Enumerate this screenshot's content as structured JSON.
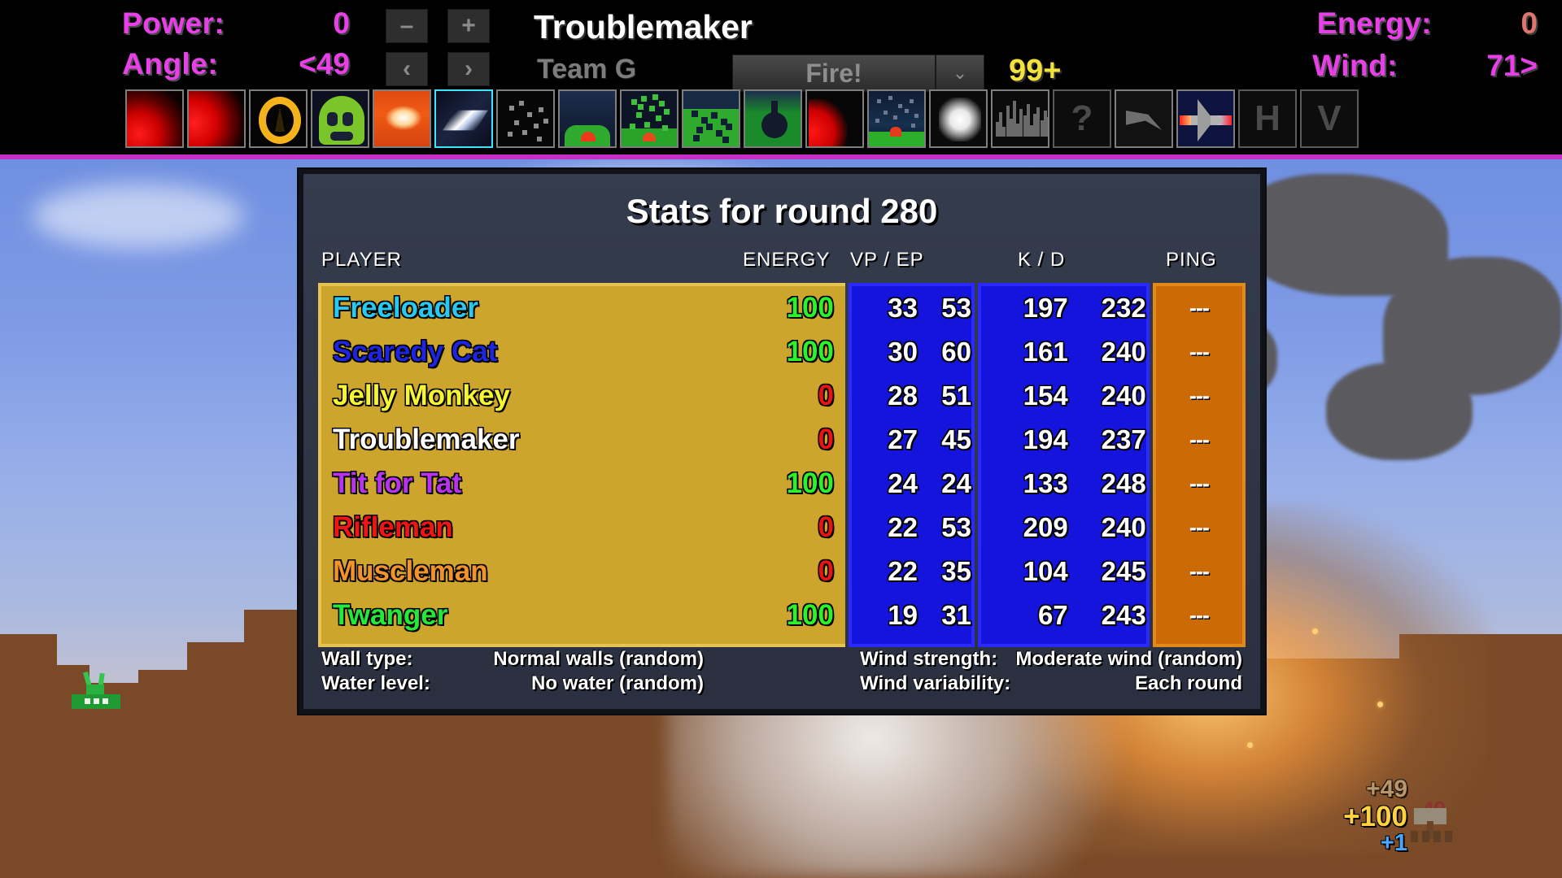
{
  "hud": {
    "power_label": "Power:",
    "power_value": "0",
    "angle_label": "Angle:",
    "angle_value": "<49",
    "power_minus": "–",
    "power_plus": "+",
    "angle_left": "‹",
    "angle_right": "›",
    "player_name": "Troublemaker",
    "team_name": "Team G",
    "fire_label": "Fire!",
    "fire_dropdown": "⌄",
    "ammo_count": "99+",
    "energy_label": "Energy:",
    "energy_value": "0",
    "wind_label": "Wind:",
    "wind_value": "71>"
  },
  "toolbar": {
    "slots": [
      {
        "name": "weapon-red-blast-1",
        "art": "i-red1",
        "selected": false
      },
      {
        "name": "weapon-red-blast-2",
        "art": "i-red2",
        "selected": false
      },
      {
        "name": "weapon-gold-ring",
        "art": "i-ring",
        "selected": false
      },
      {
        "name": "weapon-green-shield",
        "art": "i-green-face",
        "selected": false
      },
      {
        "name": "weapon-explosion",
        "art": "i-explode",
        "selected": false
      },
      {
        "name": "weapon-energy-beam",
        "art": "i-beam",
        "selected": true
      },
      {
        "name": "weapon-scatter-dots",
        "art": "i-dots",
        "selected": false
      },
      {
        "name": "weapon-dirt-mound",
        "art": "i-hill",
        "selected": false
      },
      {
        "name": "weapon-dirt-scatter",
        "art": "i-dark-dots",
        "selected": false
      },
      {
        "name": "weapon-green-terrain",
        "art": "i-green-terrain",
        "selected": false
      },
      {
        "name": "weapon-bomb-drop",
        "art": "i-bomb",
        "selected": false
      },
      {
        "name": "weapon-red-burst",
        "art": "i-redburst",
        "selected": false
      },
      {
        "name": "weapon-night-strike",
        "art": "i-night",
        "selected": false
      },
      {
        "name": "weapon-white-flash",
        "art": "i-white",
        "selected": false
      },
      {
        "name": "weapon-seismic-wave",
        "art": "i-wave",
        "selected": false
      },
      {
        "name": "weapon-unknown",
        "art": "glyph",
        "glyph": "?",
        "selected": false
      },
      {
        "name": "weapon-arrow-shot",
        "art": "i-arrow",
        "selected": false
      },
      {
        "name": "weapon-airstrike-plane",
        "art": "i-plane",
        "selected": false
      },
      {
        "name": "toggle-horizontal",
        "art": "glyph",
        "glyph": "H",
        "selected": false
      },
      {
        "name": "toggle-vertical",
        "art": "glyph",
        "glyph": "V",
        "selected": false
      }
    ]
  },
  "dialog": {
    "title": "Stats for round 280",
    "headers": {
      "player": "PLAYER",
      "energy": "ENERGY",
      "vp_ep": "VP  /  EP",
      "k_d": "K  /  D",
      "ping": "PING"
    },
    "rows": [
      {
        "name": "Freeloader",
        "name_color": "#29c8f0",
        "energy": "100",
        "energy_color": "#2bf22b",
        "vp": "33",
        "ep": "53",
        "k": "197",
        "d": "232",
        "ping": "---"
      },
      {
        "name": "Scaredy Cat",
        "name_color": "#1f24e0",
        "energy": "100",
        "energy_color": "#2bf22b",
        "vp": "30",
        "ep": "60",
        "k": "161",
        "d": "240",
        "ping": "---"
      },
      {
        "name": "Jelly Monkey",
        "name_color": "#f5f531",
        "energy": "0",
        "energy_color": "#e81414",
        "vp": "28",
        "ep": "51",
        "k": "154",
        "d": "240",
        "ping": "---"
      },
      {
        "name": "Troublemaker",
        "name_color": "#ffffff",
        "energy": "0",
        "energy_color": "#e81414",
        "vp": "27",
        "ep": "45",
        "k": "194",
        "d": "237",
        "ping": "---"
      },
      {
        "name": "Tit for Tat",
        "name_color": "#b733f0",
        "energy": "100",
        "energy_color": "#2bf22b",
        "vp": "24",
        "ep": "24",
        "k": "133",
        "d": "248",
        "ping": "---"
      },
      {
        "name": "Rifleman",
        "name_color": "#f01414",
        "energy": "0",
        "energy_color": "#e81414",
        "vp": "22",
        "ep": "53",
        "k": "209",
        "d": "240",
        "ping": "---"
      },
      {
        "name": "Muscleman",
        "name_color": "#f2922a",
        "energy": "0",
        "energy_color": "#e81414",
        "vp": "22",
        "ep": "35",
        "k": "104",
        "d": "245",
        "ping": "---"
      },
      {
        "name": "Twanger",
        "name_color": "#24e83a",
        "energy": "100",
        "energy_color": "#2bf22b",
        "vp": "19",
        "ep": "31",
        "k": "67",
        "d": "243",
        "ping": "---"
      }
    ],
    "footer": {
      "wall_type_label": "Wall type:",
      "wall_type_value": "Normal walls (random)",
      "water_level_label": "Water level:",
      "water_level_value": "No water (random)",
      "wind_strength_label": "Wind strength:",
      "wind_strength_value": "Moderate wind (random)",
      "wind_variability_label": "Wind variability:",
      "wind_variability_value": "Each round"
    }
  },
  "world": {
    "score_popups": [
      {
        "text": "+49",
        "cls": "pop-49"
      },
      {
        "text": "+100",
        "cls": "pop-100"
      },
      {
        "text": "+1",
        "cls": "pop-1"
      }
    ],
    "tank_damage_number": "49"
  }
}
